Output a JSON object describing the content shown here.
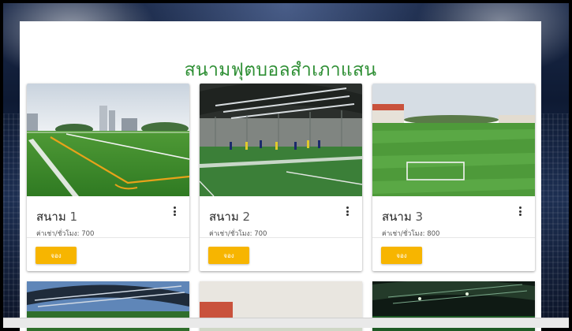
{
  "page": {
    "title": "สนามฟุตบอลสำเภาแสน"
  },
  "fields": [
    {
      "name": "สนาม",
      "number": "1",
      "price": "ค่าเช่า/ชั่วโมง: 700",
      "book_label": "จอง"
    },
    {
      "name": "สนาม",
      "number": "2",
      "price": "ค่าเช่า/ชั่วโมง: 700",
      "book_label": "จอง"
    },
    {
      "name": "สนาม",
      "number": "3",
      "price": "ค่าเช่า/ชั่วโมง: 800",
      "book_label": "จอง"
    }
  ],
  "colors": {
    "title_green": "#2f8f35",
    "button_yellow": "#f7b500",
    "grass": "#3d8a2a"
  },
  "icons": {
    "card_menu": "more-vert-icon"
  }
}
